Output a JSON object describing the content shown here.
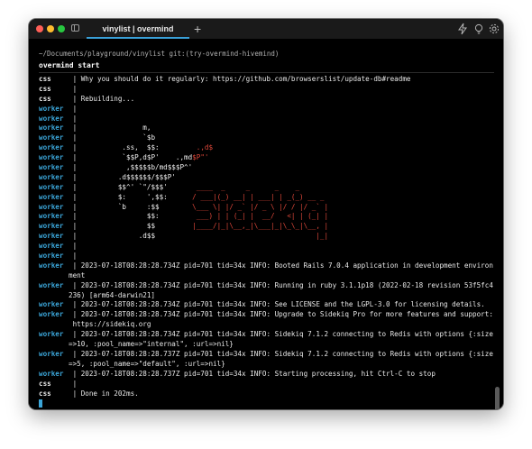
{
  "window": {
    "tab_title": "vinylist | overmind",
    "new_tab_label": "+"
  },
  "terminal": {
    "path": "~/Documents/playground/vinylist git:(try-overmind-hivemind)",
    "command": "overmind start",
    "lines": [
      {
        "proc": "css",
        "text": "Why you should do it regularly: https://github.com/browserslist/update-db#readme"
      },
      {
        "proc": "css",
        "text": ""
      },
      {
        "proc": "css",
        "text": "Rebuilding..."
      },
      {
        "proc": "worker",
        "text": ""
      },
      {
        "proc": "worker",
        "text": ""
      },
      {
        "proc": "worker",
        "text": "               m,"
      },
      {
        "proc": "worker",
        "text": "               `$b"
      },
      {
        "proc": "worker",
        "text": "          .ss,  $$:         .,d$"
      },
      {
        "proc": "worker",
        "text": "          `$$P,d$P'    .,md$P\"'"
      },
      {
        "proc": "worker",
        "text": "           ,$$$$$b/md$$$P^'"
      },
      {
        "proc": "worker",
        "text": "         .d$$$$$$/$$$P'"
      },
      {
        "proc": "worker",
        "text": "         $$^' `\"/$$$'       ____  _     _      _    _"
      },
      {
        "proc": "worker",
        "text": "         $:     ',$$:      / ___|(_) __| | ___| | _(_) __ _"
      },
      {
        "proc": "worker",
        "text": "         `b     :$$        \\___ \\| |/ _` |/ _ \\ |/ / |/ _` |"
      },
      {
        "proc": "worker",
        "text": "                $$:         ___) | | (_| |  __/   <| | (_| |"
      },
      {
        "proc": "worker",
        "text": "                $$         |____/|_|\\__,_|\\___|_|\\_\\_|\\__, |"
      },
      {
        "proc": "worker",
        "text": "              .d$$                                       |_|"
      },
      {
        "proc": "worker",
        "text": ""
      },
      {
        "proc": "worker",
        "text": ""
      },
      {
        "proc": "worker",
        "text": "2023-07-18T08:28:28.734Z pid=701 tid=34x INFO: Booted Rails 7.0.4 application in development environ"
      },
      {
        "proc": "",
        "text": "ment"
      },
      {
        "proc": "worker",
        "text": "2023-07-18T08:28:28.734Z pid=701 tid=34x INFO: Running in ruby 3.1.1p18 (2022-02-18 revision 53f5fc4"
      },
      {
        "proc": "",
        "text": "236) [arm64-darwin21]"
      },
      {
        "proc": "worker",
        "text": "2023-07-18T08:28:28.734Z pid=701 tid=34x INFO: See LICENSE and the LGPL-3.0 for licensing details."
      },
      {
        "proc": "worker",
        "text": "2023-07-18T08:28:28.734Z pid=701 tid=34x INFO: Upgrade to Sidekiq Pro for more features and support:"
      },
      {
        "proc": "",
        "text": " https://sidekiq.org"
      },
      {
        "proc": "worker",
        "text": "2023-07-18T08:28:28.734Z pid=701 tid=34x INFO: Sidekiq 7.1.2 connecting to Redis with options {:size"
      },
      {
        "proc": "",
        "text": "=>10, :pool_name=>\"internal\", :url=>nil}"
      },
      {
        "proc": "worker",
        "text": "2023-07-18T08:28:28.737Z pid=701 tid=34x INFO: Sidekiq 7.1.2 connecting to Redis with options {:size"
      },
      {
        "proc": "",
        "text": "=>5, :pool_name=>\"default\", :url=>nil}"
      },
      {
        "proc": "worker",
        "text": "2023-07-18T08:28:28.737Z pid=701 tid=34x INFO: Starting processing, hit Ctrl-C to stop"
      },
      {
        "proc": "css",
        "text": ""
      },
      {
        "proc": "css",
        "text": "Done in 202ms."
      }
    ]
  },
  "colors": {
    "worker": "#3ba5d8",
    "css": "#e8e8e8",
    "ascii_logo": "#e0483a",
    "tab_accent": "#3aa0d8"
  },
  "icons": {
    "sidebar": "sidebar-toggle-icon",
    "bolt": "lightning-icon",
    "bulb": "lightbulb-icon",
    "settings": "gear-icon"
  }
}
